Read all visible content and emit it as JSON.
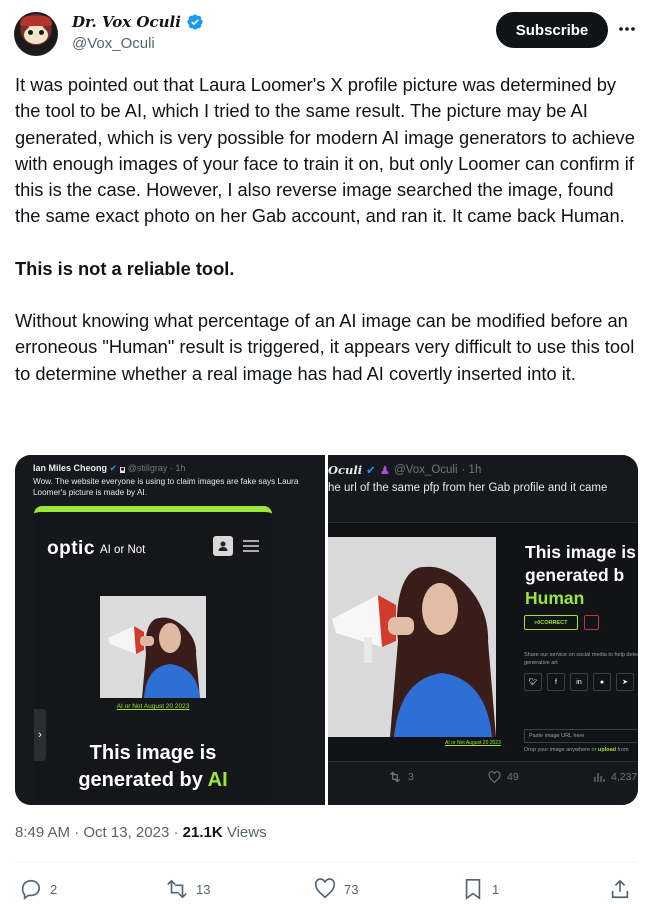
{
  "author": {
    "display_name": "Dr. Vox Oculi",
    "handle": "@Vox_Oculi",
    "verified": true
  },
  "header": {
    "subscribe_label": "Subscribe",
    "more_icon": "more-dots-icon"
  },
  "tweet": {
    "paragraph_1": "It was pointed out that Laura Loomer's X profile picture was determined by the tool to be AI, which I tried to the same result. The picture may be AI generated, which is very possible for modern AI image generators to achieve with enough images of your face to train it on, but only Loomer can confirm if this is the case. However, I also reverse image searched the image, found the same exact photo on her Gab account, and ran it. It came back Human.",
    "paragraph_2_bold": "This is not a reliable tool.",
    "paragraph_3": "Without knowing what percentage of an AI image can be modified before an erroneous \"Human\" result is triggered, it appears very difficult to use this tool to determine whether a real image has had AI covertly inserted into it."
  },
  "media_left": {
    "author": "Ian Miles Cheong",
    "handle": "@stillgray",
    "time": "· 1h",
    "text": "Wow. The website everyone is using to claim images are fake says Laura Loomer's picture is made by AI.",
    "logo": "optic",
    "logo_sub": "AI or Not",
    "photo_date": "AI or Not August 20 2023",
    "verdict_line1": "This image is",
    "verdict_line2": "generated by",
    "verdict_ai": "AI"
  },
  "media_right": {
    "author_partial": "Oculi",
    "handle": "@Vox_Oculi",
    "time": "· 1h",
    "text": "he url of the same pfp from her Gab profile and it came",
    "verdict_line1": "This image is",
    "verdict_line2": "generated b",
    "verdict_human": "Human",
    "correct_label": "CORRECT",
    "share_text": "Share our service on social media to help detect generative art",
    "url_placeholder": "Paste image URL here",
    "drop_text_prefix": "Drop your image anywhere or",
    "drop_text_link": "upload",
    "drop_text_suffix": "from",
    "photo_date": "AI or Not August 20 2023",
    "retweets": "3",
    "likes": "49",
    "views": "4,237"
  },
  "meta": {
    "time": "8:49 AM",
    "date": "Oct 13, 2023",
    "separator": "·",
    "views_count": "21.1K",
    "views_label": "Views"
  },
  "actions": {
    "replies": "2",
    "reposts": "13",
    "likes": "73",
    "bookmarks": "1"
  },
  "colors": {
    "brand_blue": "#1d9bf0",
    "optic_green": "#9ae63a",
    "text_primary": "#0f1419",
    "text_secondary": "#536471"
  }
}
